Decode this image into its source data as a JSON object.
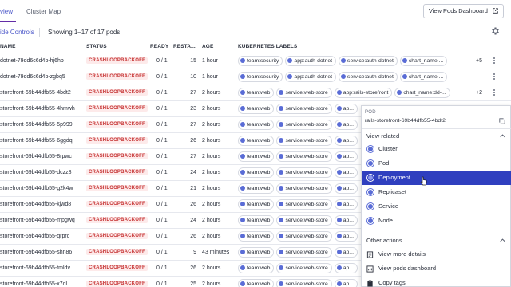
{
  "tabs": {
    "overview": "view",
    "cluster_map": "Cluster Map",
    "view_dashboard": "View Pods Dashboard"
  },
  "controls": {
    "hide_controls": "ide Controls",
    "showing": "Showing 1–17 of 17 pods"
  },
  "columns": {
    "name": "NAME",
    "status": "STATUS",
    "ready": "READY",
    "restarts": "RESTA...",
    "age": "AGE",
    "labels": "KUBERNETES LABELS"
  },
  "rows": [
    {
      "name": "dotnet-79dd6c6d4b-hj6hp",
      "status": "CRASHLOOPBACKOFF",
      "ready": "0 / 1",
      "restarts": "15",
      "age": "1 hour",
      "labels": [
        "team:security",
        "app:auth-dotnet",
        "service:auth-dotnet",
        "chart_name:..."
      ],
      "more": "+5"
    },
    {
      "name": "dotnet-79dd6c6d4b-zgbq5",
      "status": "CRASHLOOPBACKOFF",
      "ready": "0 / 1",
      "restarts": "10",
      "age": "1 hour",
      "labels": [
        "team:security",
        "app:auth-dotnet",
        "service:auth-dotnet",
        "chart_name:..."
      ],
      "more": ""
    },
    {
      "name": "storefront-69b44dfb55-4bdt2",
      "status": "CRASHLOOPBACKOFF",
      "ready": "0 / 1",
      "restarts": "27",
      "age": "2 hours",
      "labels": [
        "team:web",
        "service:web-store",
        "app:rails-storefront",
        "chart_name:dd-..."
      ],
      "more": "+2"
    },
    {
      "name": "storefront-69b44dfb55-4hmwh",
      "status": "CRASHLOOPBACKOFF",
      "ready": "0 / 1",
      "restarts": "23",
      "age": "2 hours",
      "labels": [
        "team:web",
        "service:web-store",
        "ap..."
      ],
      "more": ""
    },
    {
      "name": "storefront-69b44dfb55-5p999",
      "status": "CRASHLOOPBACKOFF",
      "ready": "0 / 1",
      "restarts": "27",
      "age": "2 hours",
      "labels": [
        "team:web",
        "service:web-store",
        "ap..."
      ],
      "more": ""
    },
    {
      "name": "storefront-69b44dfb55-6ggdq",
      "status": "CRASHLOOPBACKOFF",
      "ready": "0 / 1",
      "restarts": "26",
      "age": "2 hours",
      "labels": [
        "team:web",
        "service:web-store",
        "ap..."
      ],
      "more": ""
    },
    {
      "name": "storefront-69b44dfb55-8rpwc",
      "status": "CRASHLOOPBACKOFF",
      "ready": "0 / 1",
      "restarts": "27",
      "age": "2 hours",
      "labels": [
        "team:web",
        "service:web-store",
        "ap..."
      ],
      "more": ""
    },
    {
      "name": "storefront-69b44dfb55-dczz8",
      "status": "CRASHLOOPBACKOFF",
      "ready": "0 / 1",
      "restarts": "24",
      "age": "2 hours",
      "labels": [
        "team:web",
        "service:web-store",
        "ap..."
      ],
      "more": ""
    },
    {
      "name": "storefront-69b44dfb55-g2k4w",
      "status": "CRASHLOOPBACKOFF",
      "ready": "0 / 1",
      "restarts": "21",
      "age": "2 hours",
      "labels": [
        "team:web",
        "service:web-store",
        "ap..."
      ],
      "more": ""
    },
    {
      "name": "storefront-69b44dfb55-kjwd8",
      "status": "CRASHLOOPBACKOFF",
      "ready": "0 / 1",
      "restarts": "26",
      "age": "2 hours",
      "labels": [
        "team:web",
        "service:web-store",
        "ap..."
      ],
      "more": ""
    },
    {
      "name": "storefront-69b44dfb55-mpgwq",
      "status": "CRASHLOOPBACKOFF",
      "ready": "0 / 1",
      "restarts": "24",
      "age": "2 hours",
      "labels": [
        "team:web",
        "service:web-store",
        "ap..."
      ],
      "more": ""
    },
    {
      "name": "storefront-69b44dfb55-qrprc",
      "status": "CRASHLOOPBACKOFF",
      "ready": "0 / 1",
      "restarts": "26",
      "age": "2 hours",
      "labels": [
        "team:web",
        "service:web-store",
        "ap..."
      ],
      "more": ""
    },
    {
      "name": "storefront-69b44dfb55-shn86",
      "status": "CRASHLOOPBACKOFF",
      "ready": "0 / 1",
      "restarts": "9",
      "age": "43 minutes",
      "labels": [
        "team:web",
        "service:web-store",
        "ap..."
      ],
      "more": ""
    },
    {
      "name": "storefront-69b44dfb55-tmldv",
      "status": "CRASHLOOPBACKOFF",
      "ready": "0 / 1",
      "restarts": "26",
      "age": "2 hours",
      "labels": [
        "team:web",
        "service:web-store",
        "ap..."
      ],
      "more": ""
    },
    {
      "name": "storefront-69b44dfb55-x7dl",
      "status": "CRASHLOOPBACKOFF",
      "ready": "0 / 1",
      "restarts": "25",
      "age": "2 hours",
      "labels": [
        "team:web",
        "service:web-store",
        "ap..."
      ],
      "more": ""
    }
  ],
  "popover": {
    "kind": "POD",
    "title": "rails-storefront-69b44dfb55-4bdt2",
    "view_related": "View related",
    "related": [
      "Cluster",
      "Pod",
      "Deployment",
      "Replicaset",
      "Service",
      "Node"
    ],
    "active_index": 2,
    "other_actions": "Other actions",
    "actions": [
      "View more details",
      "View pods dashboard",
      "Copy tags"
    ]
  },
  "colors": {
    "accent": "#2f3fbf",
    "status_error": "#c63434",
    "label_dot": "#5a6cd6"
  }
}
